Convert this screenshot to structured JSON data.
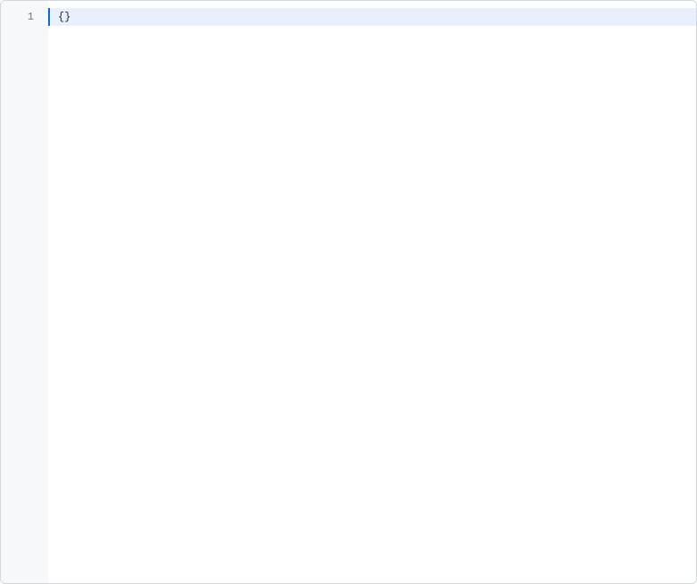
{
  "editor": {
    "lines": [
      {
        "number": "1",
        "content": "{}",
        "highlighted": true
      }
    ]
  }
}
